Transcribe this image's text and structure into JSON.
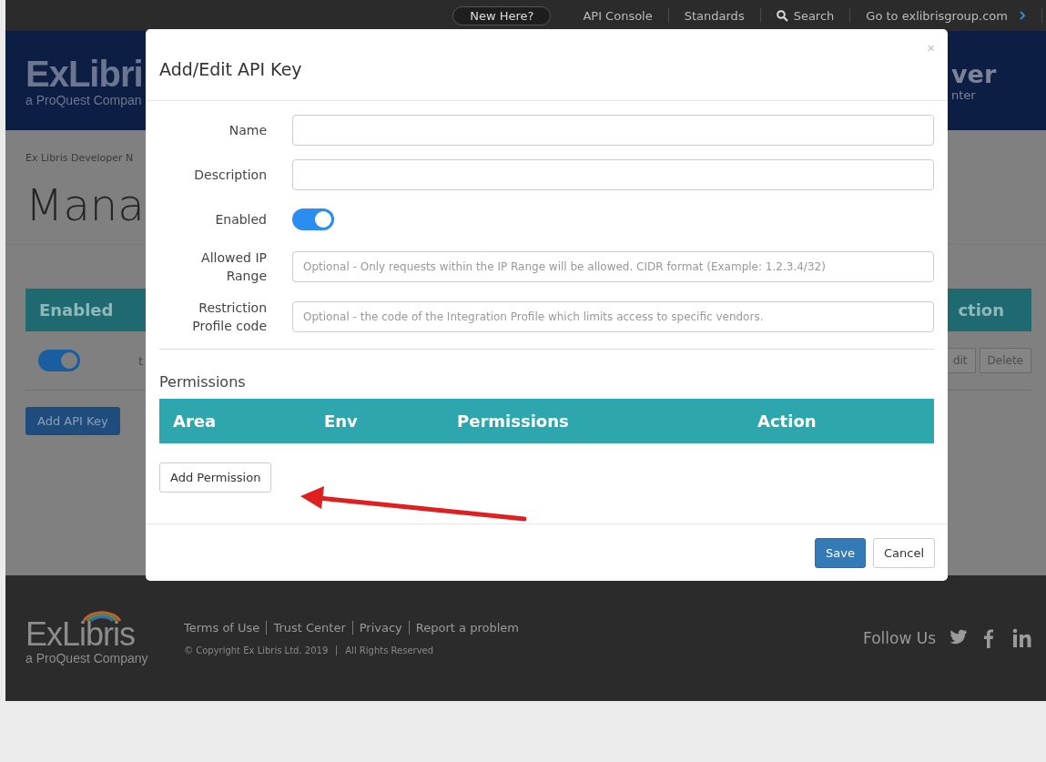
{
  "top_nav": {
    "items": [
      {
        "kind": "pill",
        "label": "New Here?"
      },
      {
        "kind": "link",
        "label": "API Console"
      },
      {
        "kind": "link",
        "label": "Standards"
      },
      {
        "kind": "search",
        "label": "Search"
      },
      {
        "kind": "external",
        "label": "Go to exlibrisgroup.com"
      }
    ]
  },
  "header": {
    "logo": "ExLibri",
    "logo_subtitle": "a ProQuest Compan",
    "title_fragment": "ver",
    "subtitle_fragment": "nter"
  },
  "breadcrumb": "Ex Libris Developer N",
  "page_title": "Mana",
  "keys_table": {
    "columns": [
      "Enabled",
      "ction"
    ],
    "rows": [
      {
        "enabled": true,
        "cell": "t",
        "buttons": [
          "dit",
          "Delete"
        ]
      }
    ]
  },
  "add_key_button": "Add API Key",
  "dialog": {
    "title": "Add/Edit API Key",
    "close": "×",
    "fields": [
      {
        "kind": "text",
        "label": "Name"
      },
      {
        "kind": "text",
        "label": "Description"
      },
      {
        "kind": "toggle",
        "label": "Enabled",
        "on": true
      },
      {
        "kind": "text",
        "label": "Allowed IP Range",
        "placeholder": "Optional - Only requests within the IP Range will be allowed. CIDR format (Example: 1.2.3.4/32)"
      },
      {
        "kind": "text",
        "label": "Restriction Profile code",
        "placeholder": "Optional - the code of the Integration Profile which limits access to specific vendors."
      }
    ],
    "permissions": {
      "heading": "Permissions",
      "columns": [
        "Area",
        "Env",
        "Permissions",
        "Action"
      ],
      "add_button": "Add Permission"
    },
    "buttons": [
      {
        "kind": "primary",
        "label": "Save"
      },
      {
        "kind": "default",
        "label": "Cancel"
      }
    ]
  },
  "footer": {
    "logo": "ExLibris",
    "logo_subtitle": "a ProQuest Company",
    "links": [
      "Terms of Use",
      "Trust Center",
      "Privacy",
      "Report a problem"
    ],
    "copyright": [
      "© Copyright Ex Libris Ltd. 2019",
      "All Rights Reserved"
    ],
    "follow": "Follow Us"
  }
}
